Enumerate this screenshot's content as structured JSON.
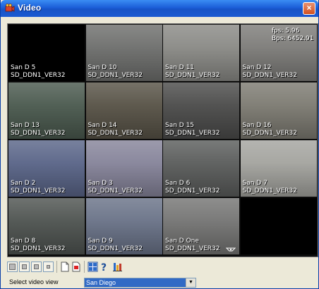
{
  "window": {
    "title": "Video",
    "close_glyph": "×"
  },
  "cameras": [
    {
      "name": "San D 5",
      "server": "SD_DDN1_VER32",
      "bg": "#000000"
    },
    {
      "name": "San D 10",
      "server": "SD_DDN1_VER32",
      "bg": "#6e6f6d"
    },
    {
      "name": "San D 11",
      "server": "SD_DDN1_VER32",
      "bg": "#8a8a86"
    },
    {
      "name": "San D 12",
      "server": "SD_DDN1_VER32",
      "bg": "#7d7c79",
      "fps": "fps: 5.96",
      "bps": "Bps:  6452.91"
    },
    {
      "name": "San D 13",
      "server": "SD_DDN1_VER32",
      "bg": "#4b5a4f"
    },
    {
      "name": "San D 14",
      "server": "SD_DDN1_VER32",
      "bg": "#585347"
    },
    {
      "name": "San D 15",
      "server": "SD_DDN1_VER32",
      "bg": "#4c4c4b"
    },
    {
      "name": "San D 16",
      "server": "SD_DDN1_VER32",
      "bg": "#7d7b72"
    },
    {
      "name": "San D 2",
      "server": "SD_DDN1_VER32",
      "bg": "#5a6588"
    },
    {
      "name": "San D 3",
      "server": "SD_DDN1_VER32",
      "bg": "#86849a"
    },
    {
      "name": "San D 6",
      "server": "SD_DDN1_VER32",
      "bg": "#5b5d5c"
    },
    {
      "name": "San D 7",
      "server": "SD_DDN1_VER32",
      "bg": "#a4a49f"
    },
    {
      "name": "San D 8",
      "server": "SD_DDN1_VER32",
      "bg": "#4f5451"
    },
    {
      "name": "San D 9",
      "server": "SD_DDN1_VER32",
      "bg": "#6a7388"
    },
    {
      "name": "San D One",
      "server": "SD_DDN1_VER32",
      "bg": "#757574",
      "ptz": true
    },
    {
      "name": "",
      "server": "",
      "bg": "#000000"
    }
  ],
  "toolbar": {
    "icons": [
      "layout-1x1-icon",
      "layout-2x2-icon",
      "layout-3x3-icon",
      "layout-4x4-icon",
      "new-view-icon",
      "record-icon",
      "grid-view-icon",
      "help-icon",
      "settings-icon"
    ]
  },
  "view_select": {
    "label": "Select video view",
    "value": "San Diego"
  },
  "colors": {
    "titlebar": "#1b5fd8",
    "window_bg": "#ece9d8",
    "selection": "#316ac5",
    "desktop": "#f7d7a6"
  }
}
